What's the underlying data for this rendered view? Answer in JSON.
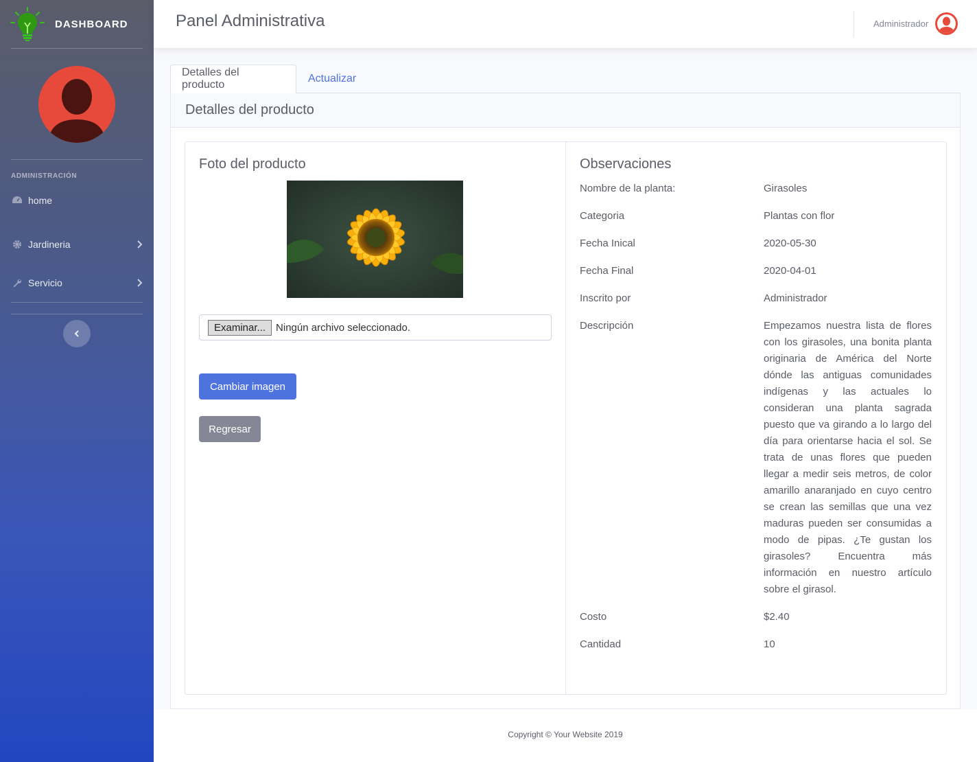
{
  "brand": {
    "title": "DASHBOARD",
    "icon": "lightbulb-icon"
  },
  "sidebar": {
    "section": "Administración",
    "items": [
      {
        "label": "home",
        "icon": "dashboard-icon"
      },
      {
        "label": "Jardineria",
        "icon": "gear-icon"
      },
      {
        "label": "Servicio",
        "icon": "wrench-icon"
      }
    ]
  },
  "topbar": {
    "title": "Panel Administrativa",
    "user": "Administrador"
  },
  "tabs": {
    "details": "Detalles del producto",
    "update": "Actualizar"
  },
  "card": {
    "header": "Detalles del producto"
  },
  "photo": {
    "title": "Foto del producto",
    "browse": "Examinar...",
    "no_file": "Ningún archivo seleccionado.",
    "change": "Cambiar imagen",
    "back": "Regresar"
  },
  "observations": {
    "title": "Observaciones",
    "rows": [
      {
        "label": "Nombre de la planta:",
        "value": "Girasoles"
      },
      {
        "label": "Categoria",
        "value": "Plantas con flor"
      },
      {
        "label": "Fecha Inical",
        "value": "2020-05-30"
      },
      {
        "label": "Fecha Final",
        "value": "2020-04-01"
      },
      {
        "label": "Inscrito por",
        "value": "Administrador"
      },
      {
        "label": "Descripción",
        "value": "Empezamos nuestra lista de flores con los girasoles, una bonita planta originaria de América del Norte dónde las antiguas comunidades indígenas y las actuales lo consideran una planta sagrada puesto que va girando a lo largo del día para orientarse hacia el sol. Se trata de unas flores que pueden llegar a medir seis metros, de color amarillo anaranjado en cuyo centro se crean las semillas que una vez maduras pueden ser consumidas a modo de pipas. ¿Te gustan los girasoles? Encuentra más información en nuestro artículo sobre el girasol."
      },
      {
        "label": "Costo",
        "value": "$2.40"
      },
      {
        "label": "Cantidad",
        "value": "10"
      }
    ]
  },
  "footer": {
    "text": "Copyright © Your Website 2019"
  },
  "colors": {
    "primary": "#4e73df",
    "secondary": "#858796",
    "avatar": "#e74a3b"
  }
}
